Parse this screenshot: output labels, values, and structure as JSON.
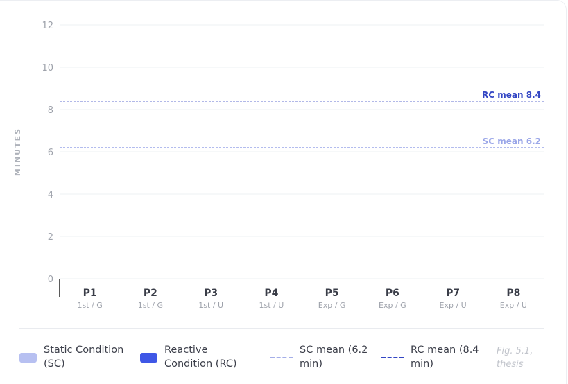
{
  "colors": {
    "sc": "#b7c0f1",
    "rc": "#3f57e6",
    "sc_mean": "#9aa6e8",
    "rc_mean": "#3346c4",
    "grid": "#eef0f3",
    "tick": "#9ea2ab",
    "axis_title": "#aeb2ba"
  },
  "chart_data": {
    "type": "bar",
    "ylabel": "MINUTES",
    "ylim": [
      0,
      12
    ],
    "yticks": [
      0,
      2,
      4,
      6,
      8,
      10,
      12
    ],
    "categories": [
      "P1",
      "P2",
      "P3",
      "P4",
      "P5",
      "P6",
      "P7",
      "P8"
    ],
    "sublabels": [
      "1st / G",
      "1st / G",
      "1st / U",
      "1st / U",
      "Exp / G",
      "Exp / G",
      "Exp / U",
      "Exp / U"
    ],
    "series": [
      {
        "name": "Static Condition (SC)",
        "values": []
      },
      {
        "name": "Reactive Condition (RC)",
        "values": []
      }
    ],
    "reference_lines": [
      {
        "label": "SC mean 6.2",
        "value": 6.2,
        "style": "dashed"
      },
      {
        "label": "RC mean 8.4",
        "value": 8.4,
        "style": "dashed"
      }
    ],
    "grid": true,
    "legend_position": "bottom"
  },
  "legend": {
    "sc": "Static Condition (SC)",
    "rc": "Reactive Condition (RC)",
    "sc_mean": "SC mean (6.2 min)",
    "rc_mean": "RC mean (8.4 min)"
  },
  "caption": "Fig. 5.1, thesis"
}
